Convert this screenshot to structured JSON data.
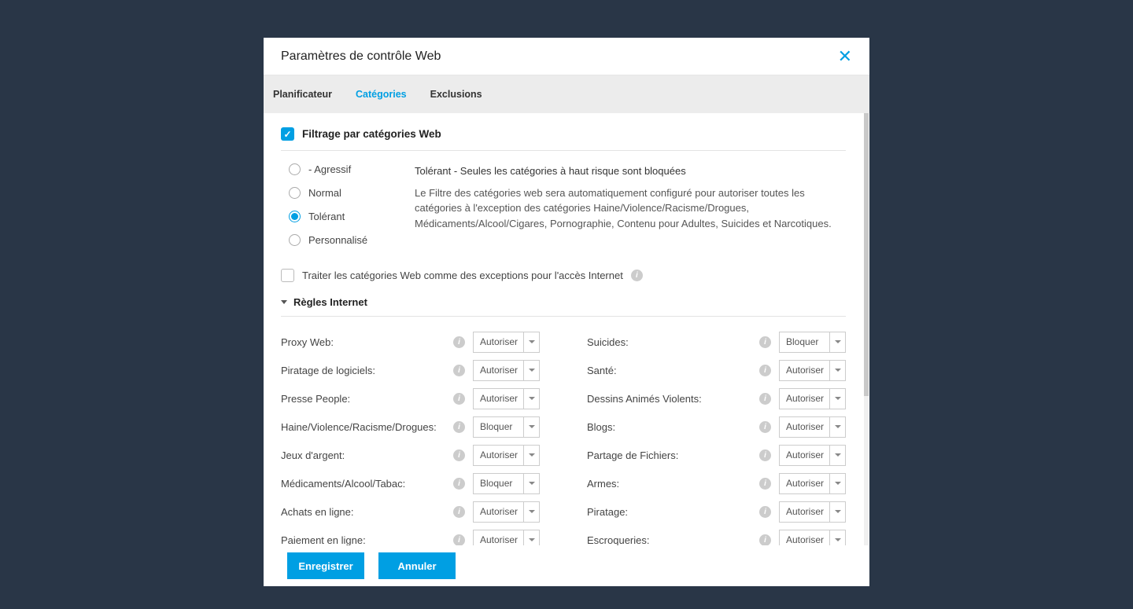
{
  "modal": {
    "title": "Paramètres de contrôle Web"
  },
  "tabs": {
    "t0": "Planificateur",
    "t1": "Catégories",
    "t2": "Exclusions"
  },
  "filter": {
    "heading": "Filtrage par catégories Web",
    "profiles": {
      "p0": "- Agressif",
      "p1": "Normal",
      "p2": "Tolérant",
      "p3": "Personnalisé"
    },
    "desc_title": "Tolérant - Seules les catégories à haut risque sont bloquées",
    "desc_body": "Le Filtre des catégories web sera automatiquement configuré pour autoriser toutes les catégories à l'exception des catégories Haine/Violence/Racisme/Drogues, Médicaments/Alcool/Cigares, Pornographie, Contenu pour Adultes, Suicides et Narcotiques.",
    "treat_label": "Traiter les catégories Web comme des exceptions pour l'accès Internet"
  },
  "rules": {
    "heading": "Règles Internet",
    "values": {
      "allow": "Autoriser",
      "block": "Bloquer"
    },
    "left": {
      "r0": {
        "label": "Proxy Web:",
        "value": "Autoriser"
      },
      "r1": {
        "label": "Piratage de logiciels:",
        "value": "Autoriser"
      },
      "r2": {
        "label": "Presse People:",
        "value": "Autoriser"
      },
      "r3": {
        "label": "Haine/Violence/Racisme/Drogues:",
        "value": "Bloquer"
      },
      "r4": {
        "label": "Jeux d'argent:",
        "value": "Autoriser"
      },
      "r5": {
        "label": "Médicaments/Alcool/Tabac:",
        "value": "Bloquer"
      },
      "r6": {
        "label": "Achats en ligne:",
        "value": "Autoriser"
      },
      "r7": {
        "label": "Paiement en ligne:",
        "value": "Autoriser"
      }
    },
    "right": {
      "r0": {
        "label": "Suicides:",
        "value": "Bloquer"
      },
      "r1": {
        "label": "Santé:",
        "value": "Autoriser"
      },
      "r2": {
        "label": "Dessins Animés Violents:",
        "value": "Autoriser"
      },
      "r3": {
        "label": "Blogs:",
        "value": "Autoriser"
      },
      "r4": {
        "label": "Partage de Fichiers:",
        "value": "Autoriser"
      },
      "r5": {
        "label": "Armes:",
        "value": "Autoriser"
      },
      "r6": {
        "label": "Piratage:",
        "value": "Autoriser"
      },
      "r7": {
        "label": "Escroqueries:",
        "value": "Autoriser"
      }
    }
  },
  "footer": {
    "save": "Enregistrer",
    "cancel": "Annuler"
  }
}
